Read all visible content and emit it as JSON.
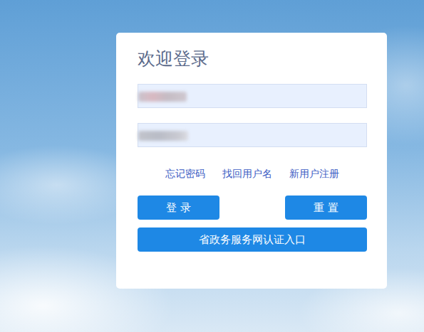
{
  "title": "欢迎登录",
  "fields": [
    {
      "kind": "text"
    },
    {
      "kind": "password"
    }
  ],
  "links": [
    "忘记密码",
    "找回用户名",
    "新用户注册"
  ],
  "buttons": [
    "登 录",
    "重 置",
    "省政务服务网认证入口"
  ]
}
